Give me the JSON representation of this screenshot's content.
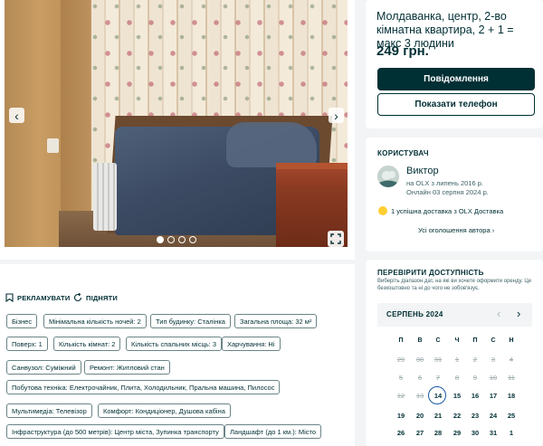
{
  "listing": {
    "title": "Молдаванка, центр, 2-во кімнатна квартира, 2 + 1 = макс 3 людини",
    "price": "249 грн.",
    "message_btn": "Повідомлення",
    "phone_btn": "Показати телефон"
  },
  "gallery": {
    "prev_icon": "‹",
    "next_icon": "›",
    "photo_count": 4,
    "active_index": 0
  },
  "user": {
    "section_label": "КОРИСТУВАЧ",
    "name": "Виктор",
    "since": "на OLX з липень 2016 р.",
    "online": "Онлайн 03 серпня 2024 р.",
    "delivery": "1 успішна доставка з OLX Доставка",
    "all_ads": "Усі оголошення автора"
  },
  "availability": {
    "section_label": "ПЕРЕВІРИТИ ДОСТУПНІСТЬ",
    "description": "Виберіть діапазон дат, на які ви хочете оформити оренду. Це безкоштовно та ні до чого не зобов'язує.",
    "month": "СЕРПЕНЬ 2024",
    "prev_icon": "‹",
    "next_icon": "›",
    "weekdays": [
      "П",
      "В",
      "С",
      "Ч",
      "П",
      "С",
      "Н"
    ],
    "weeks": [
      [
        "29",
        "30",
        "31",
        "1",
        "2",
        "3",
        "4"
      ],
      [
        "5",
        "6",
        "7",
        "8",
        "9",
        "10",
        "11"
      ],
      [
        "12",
        "13",
        "14",
        "15",
        "16",
        "17",
        "18"
      ],
      [
        "19",
        "20",
        "21",
        "22",
        "23",
        "24",
        "25"
      ],
      [
        "26",
        "27",
        "28",
        "29",
        "30",
        "31",
        "1"
      ]
    ],
    "today": "14"
  },
  "actions": {
    "promote": "РЕКЛАМУВАТИ",
    "raise": "ПІДНЯТИ"
  },
  "tags": [
    "Бізнес",
    "Мінімальна кількість ночей: 2",
    "Тип будинку: Сталінка",
    "Загальна площа: 32 м²",
    "Поверх: 1",
    "Кількість кімнат: 2",
    "Кількість спальних місць: 3",
    "Харчування: Ні",
    "Санвузол: Суміжний",
    "Ремонт: Житловий стан",
    "Побутова техніка: Електрочайник, Плита, Холодильник, Пральна машина, Пилосос",
    "Мультимедіа: Телевізор",
    "Комфорт: Кондиціонер, Душова кабіна",
    "Інфраструктура (до 500 метрів): Центр міста, Зупинка транспорту",
    "Ландшафт (до 1 км.): Місто"
  ]
}
